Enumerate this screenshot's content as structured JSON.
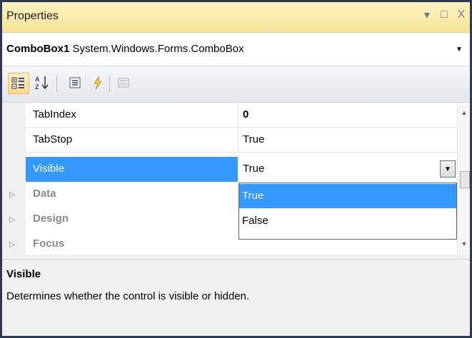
{
  "window": {
    "title": "Properties",
    "buttons": {
      "menu": "▾",
      "maximize": "□",
      "close": "X"
    }
  },
  "object_selector": {
    "name": "ComboBox1",
    "type": "System.Windows.Forms.ComboBox"
  },
  "toolbar": {
    "icons": [
      "categorized-icon",
      "alphabetical-icon",
      "properties-icon",
      "events-icon",
      "property-pages-icon"
    ],
    "active": "categorized-icon"
  },
  "grid": {
    "properties": [
      {
        "name": "TabIndex",
        "value": "0",
        "bold": true
      },
      {
        "name": "TabStop",
        "value": "True"
      },
      {
        "name": "Visible",
        "value": "True",
        "selected": true
      }
    ],
    "categories": [
      "Data",
      "Design",
      "Focus"
    ]
  },
  "dropdown": {
    "options": [
      "True",
      "False"
    ],
    "highlighted": "True"
  },
  "description": {
    "title": "Visible",
    "text": "Determines whether the control is visible or hidden."
  },
  "colors": {
    "selection": "#3399ff",
    "titlebar": "#f6e39a",
    "frame": "#2b3a55"
  }
}
